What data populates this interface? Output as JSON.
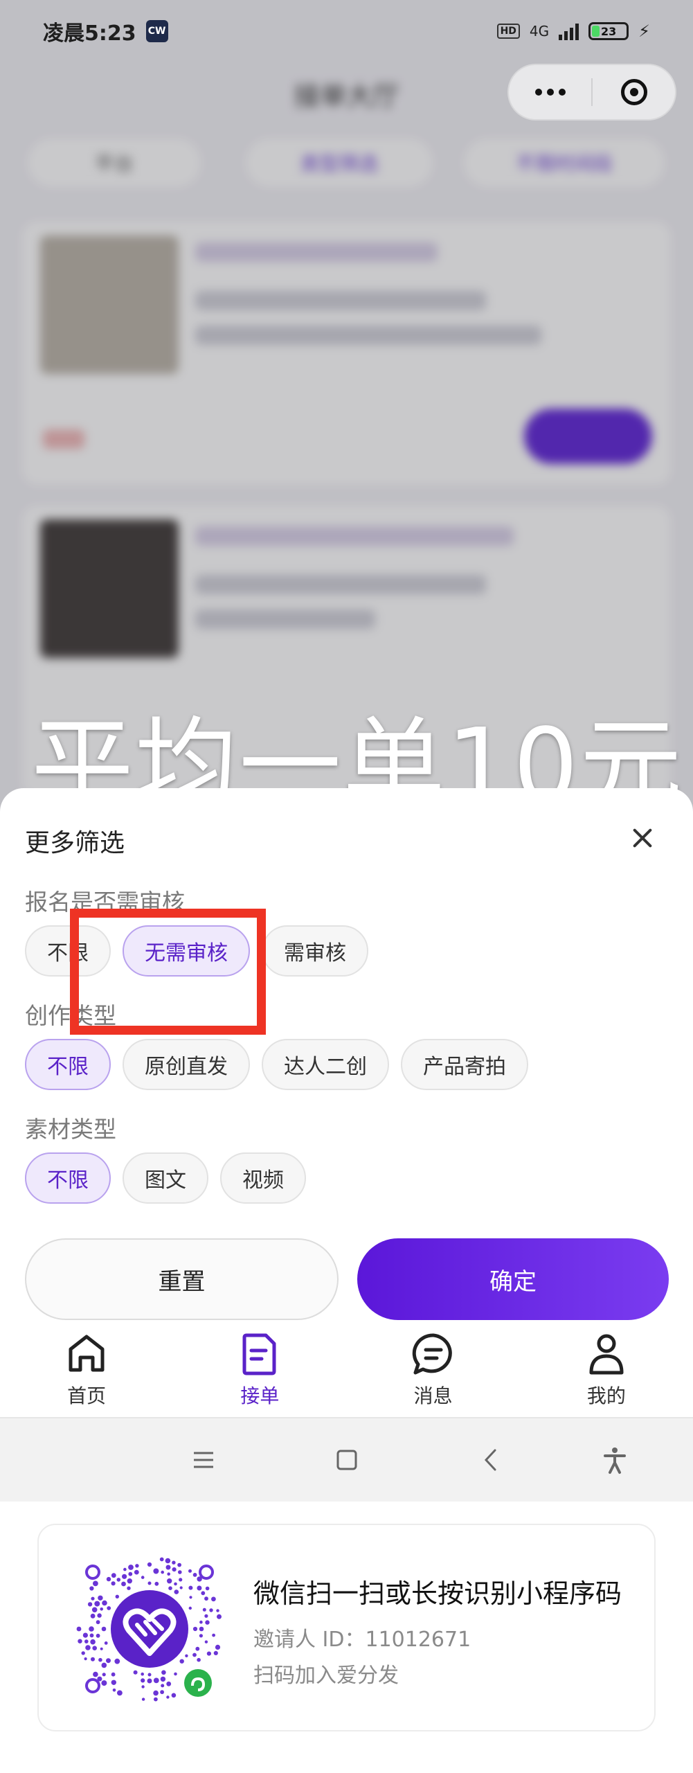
{
  "status_bar": {
    "time": "凌晨5:23",
    "hd": "HD",
    "network": "4G",
    "battery": "23",
    "battery_level": 0.23
  },
  "background_page": {
    "title": "接单大厅",
    "filter_pills": [
      "平台",
      "类型筛选",
      "不限时间段"
    ]
  },
  "overlay_caption": "平均一单10元",
  "filter_sheet": {
    "title": "更多筛选",
    "groups": [
      {
        "label": "报名是否需审核",
        "options": [
          "不限",
          "无需审核",
          "需审核"
        ],
        "selected": "无需审核"
      },
      {
        "label": "创作类型",
        "options": [
          "不限",
          "原创直发",
          "达人二创",
          "产品寄拍"
        ],
        "selected": "不限"
      },
      {
        "label": "素材类型",
        "options": [
          "不限",
          "图文",
          "视频"
        ],
        "selected": "不限"
      }
    ],
    "reset_label": "重置",
    "confirm_label": "确定"
  },
  "tab_bar": {
    "items": [
      {
        "label": "首页",
        "icon": "home-icon"
      },
      {
        "label": "接单",
        "icon": "order-document-icon"
      },
      {
        "label": "消息",
        "icon": "message-bubble-icon"
      },
      {
        "label": "我的",
        "icon": "person-icon"
      }
    ],
    "active": "接单"
  },
  "share_card": {
    "title": "微信扫一扫或长按识别小程序码",
    "inviter": "邀请人 ID：11012671",
    "hint": "扫码加入爱分发"
  },
  "colors": {
    "accent": "#5a22c8",
    "highlight_box": "#ee3324",
    "selected_chip_bg": "#efe9fc"
  }
}
